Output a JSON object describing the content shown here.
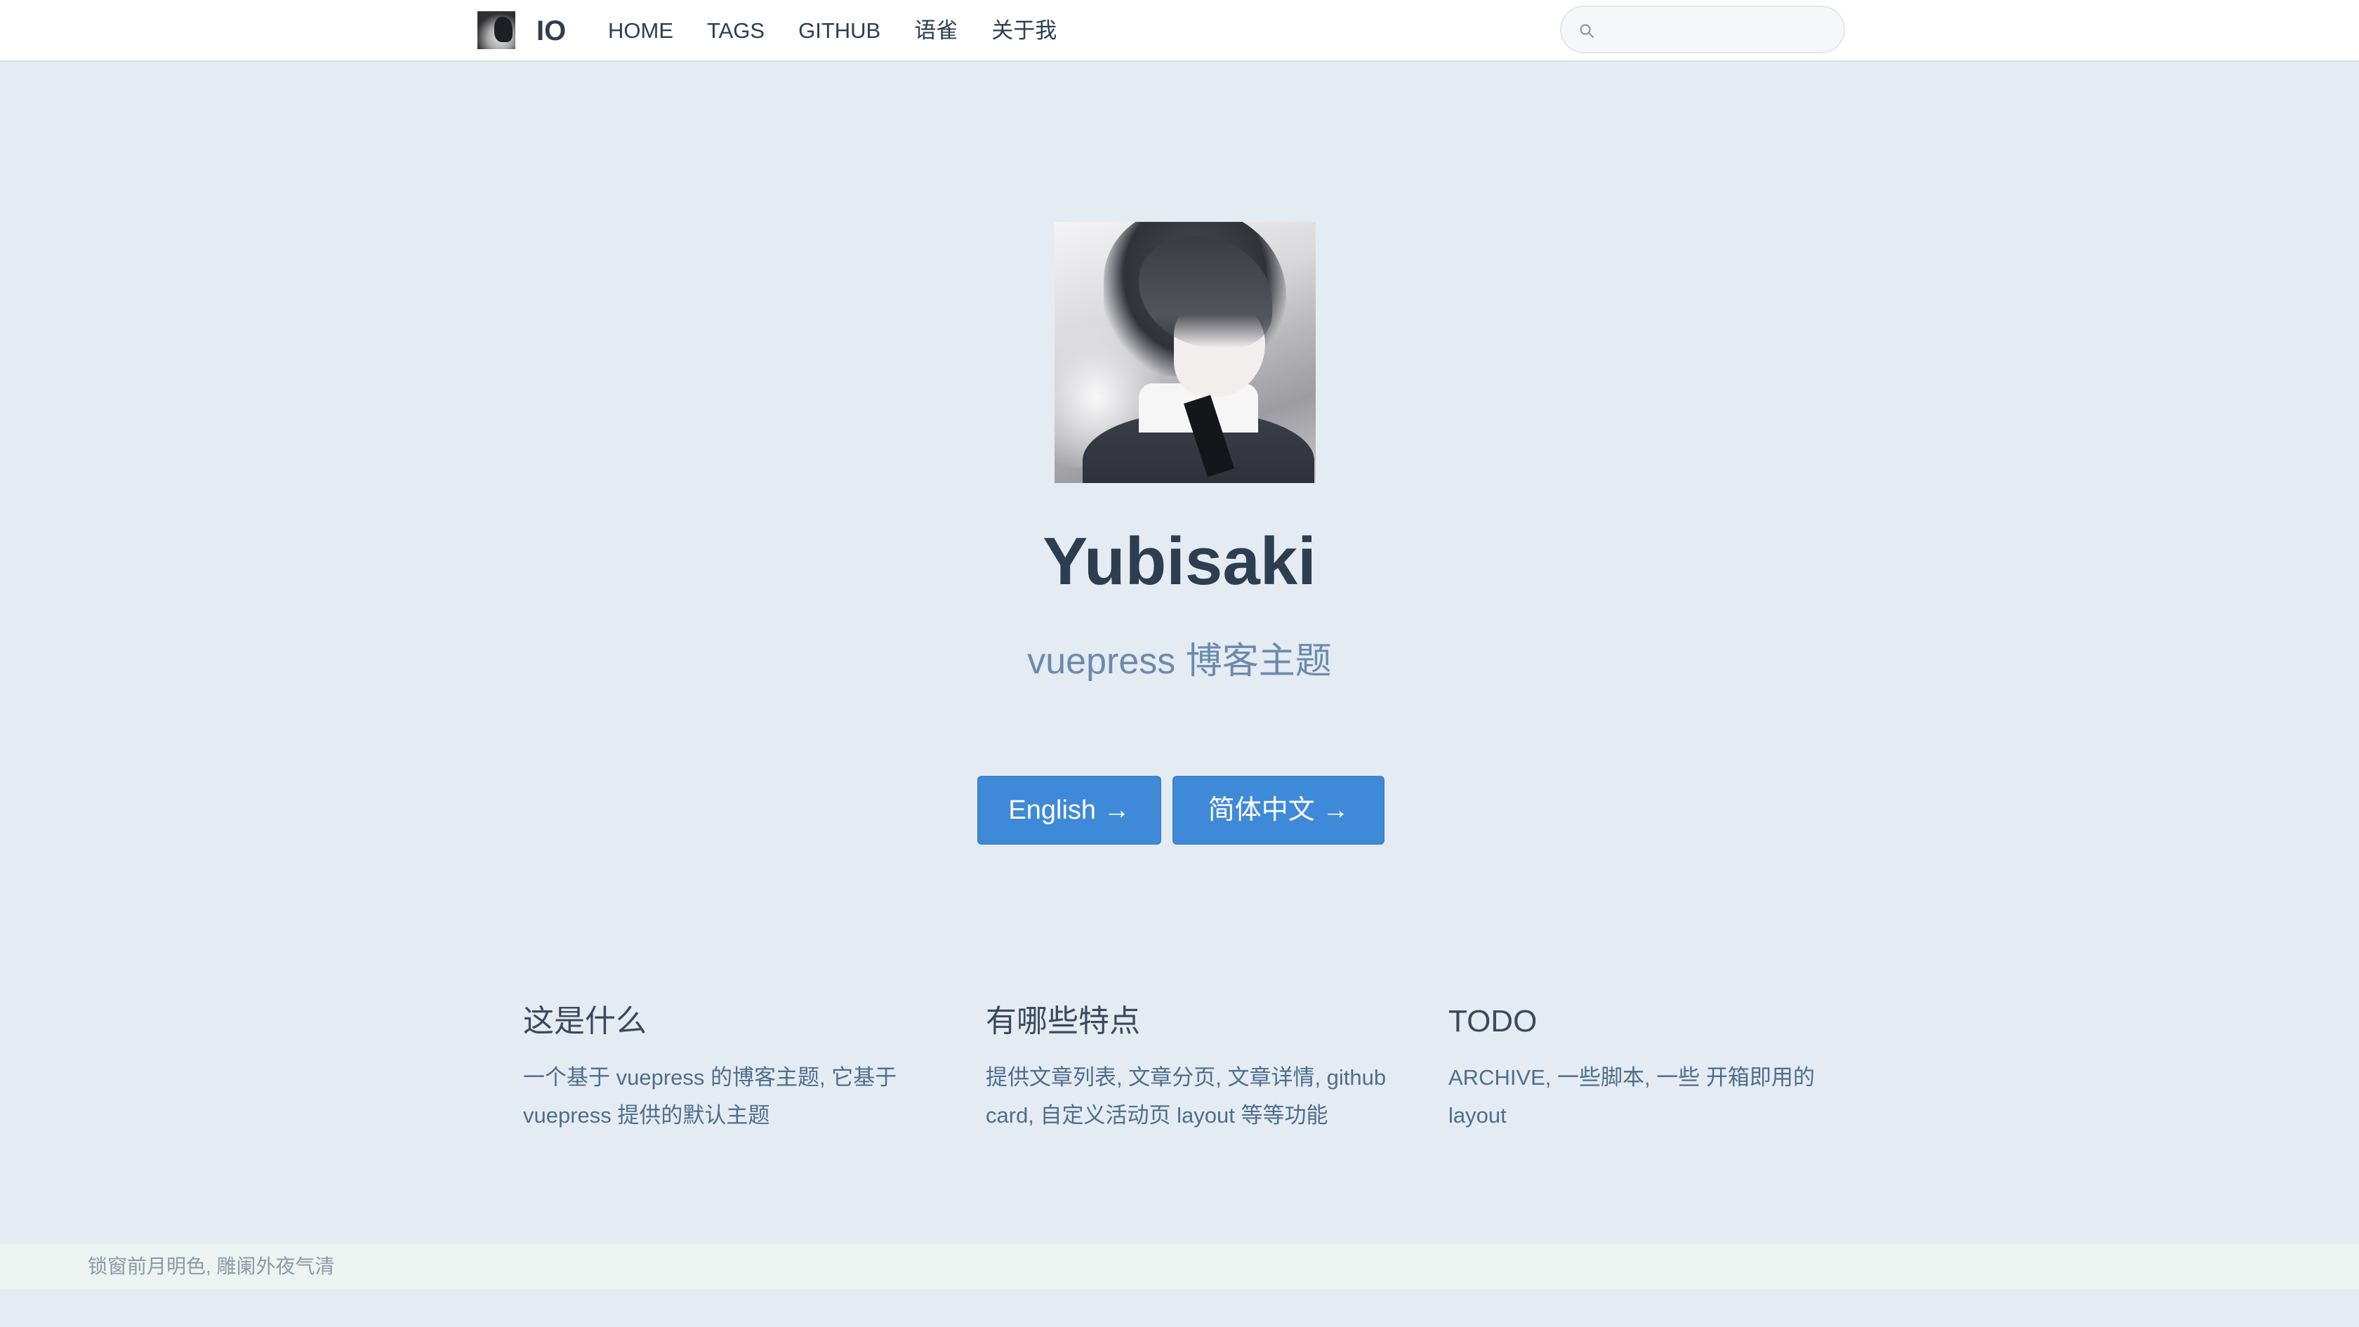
{
  "navbar": {
    "logo_icon": "avatar-logo-icon",
    "title": "IO",
    "links": [
      "HOME",
      "TAGS",
      "GITHUB",
      "语雀",
      "关于我"
    ],
    "search": {
      "placeholder": "",
      "value": "",
      "icon": "search-icon"
    }
  },
  "hero": {
    "image_icon": "anime-avatar-image",
    "name": "Yubisaki",
    "description": "vuepress 博客主题",
    "actions": [
      {
        "label": "English →"
      },
      {
        "label": "简体中文 →"
      }
    ]
  },
  "features": [
    {
      "title": "这是什么",
      "details": "一个基于 vuepress 的博客主题, 它基于 vuepress 提供的默认主题"
    },
    {
      "title": "有哪些特点",
      "details": "提供文章列表, 文章分页, 文章详情, github card, 自定义活动页 layout 等等功能"
    },
    {
      "title": "TODO",
      "details": "ARCHIVE, 一些脚本, 一些 开箱即用的 layout"
    }
  ],
  "footer": {
    "text": "锁窗前月明色, 雕阑外夜气清"
  },
  "colors": {
    "page_background": "#e5ebf2",
    "navbar_background": "#ffffff",
    "accent": "#3f8ad8",
    "text": "#2c3e50",
    "description": "#6a8bad",
    "footer_background": "#edf3f0"
  }
}
